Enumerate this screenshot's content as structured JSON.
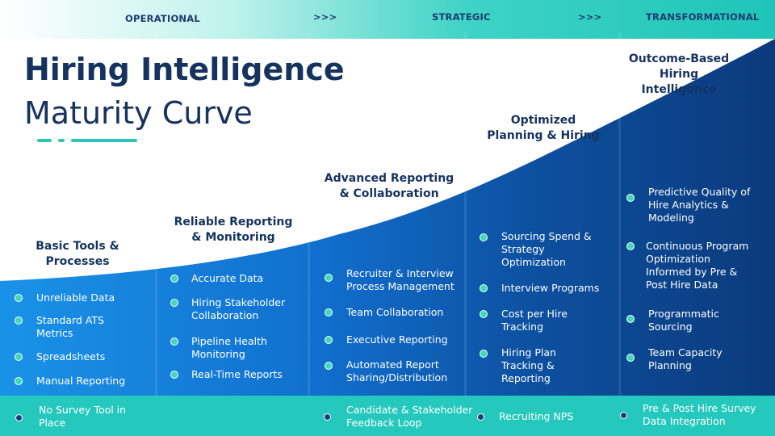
{
  "phases": {
    "p1": "OPERATIONAL",
    "arrow1": ">>>",
    "p2": "STRATEGIC",
    "arrow2": ">>>",
    "p3": "TRANSFORMATIONAL"
  },
  "title": {
    "line1": "Hiring Intelligence",
    "line2": "Maturity Curve"
  },
  "columns": [
    {
      "heading_lines": [
        "Basic Tools &",
        "Processes"
      ],
      "items": [
        [
          "Unreliable Data"
        ],
        [
          "Standard ATS",
          "Metrics"
        ],
        [
          "Spreadsheets"
        ],
        [
          "Manual Reporting"
        ]
      ]
    },
    {
      "heading_lines": [
        "Reliable Reporting",
        "& Monitoring"
      ],
      "items": [
        [
          "Accurate Data"
        ],
        [
          "Hiring Stakeholder",
          "Collaboration"
        ],
        [
          "Pipeline Health",
          "Monitoring"
        ],
        [
          "Real-Time Reports"
        ]
      ]
    },
    {
      "heading_lines": [
        "Advanced Reporting",
        "& Collaboration"
      ],
      "items": [
        [
          "Recruiter & Interview",
          "Process Management"
        ],
        [
          "Team Collaboration"
        ],
        [
          "Executive Reporting"
        ],
        [
          "Automated Report",
          "Sharing/Distribution"
        ]
      ]
    },
    {
      "heading_lines": [
        "Optimized",
        "Planning & Hiring"
      ],
      "items": [
        [
          "Sourcing Spend &",
          "Strategy",
          "Optimization"
        ],
        [
          "Interview Programs"
        ],
        [
          "Cost per Hire",
          "Tracking"
        ],
        [
          "Hiring Plan",
          "Tracking &",
          "Reporting"
        ]
      ]
    },
    {
      "heading_lines": [
        "Outcome-Based",
        "Hiring Intelligence"
      ],
      "items": [
        [
          "Predictive Quality of",
          "Hire Analytics &",
          "Modeling"
        ],
        [
          "Continuous Program",
          "Optimization",
          "Informed by Pre &",
          "Post Hire Data"
        ],
        [
          "Programmatic",
          "Sourcing"
        ],
        [
          "Team Capacity",
          "Planning"
        ]
      ]
    }
  ],
  "footer": [
    [
      "No Survey Tool in",
      "Place"
    ],
    [
      "Candidate & Stakeholder",
      "Feedback Loop"
    ],
    [
      "Recruiting NPS"
    ],
    [
      "Pre & Post Hire Survey",
      "Data Integration"
    ]
  ],
  "colors": {
    "navy": "#16325e",
    "teal": "#24c8bc",
    "blue_light": "#1a8de0",
    "blue_dark": "#0c3f86",
    "dot": "#3fd9b7"
  }
}
